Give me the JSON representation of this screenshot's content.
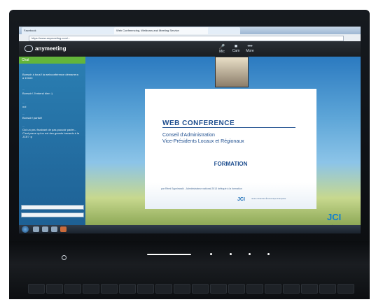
{
  "browser": {
    "tabs": [
      "Facebook",
      "",
      "",
      "Web Conferencing, Webinars and Meeting Service",
      ""
    ],
    "url": "https://www.anymeeting.com/..."
  },
  "app": {
    "logo_text": "anymeeting",
    "toolbar_buttons": [
      "Mic",
      "Cam",
      "More"
    ]
  },
  "chat": {
    "header_label": "Chat",
    "messages": [
      {
        "text": "Bonsoir à tous!! la webconférence démarrera à 19h00"
      },
      {
        "text": "Bonsoir! J'entend bien :)"
      },
      {
        "text": "oui"
      },
      {
        "text": "Bonsoir! parfait!"
      },
      {
        "text": "Ooi un peu frustrant de pas pouvoir parler... C'est parce qu'on est des grands bavards à la JCE? :p"
      }
    ]
  },
  "slide": {
    "title": "WEB CONFERENCE",
    "subtitle_line1": "Conseil d'Administration",
    "subtitle_line2": "Vice-Présidents Locaux et Régionaux",
    "heading": "FORMATION",
    "footer": "par Rémi Sypniewski - Administrateur national 2013 délégué à la formation",
    "brand": "JCI",
    "org_line": "Jeune Chambre Économique Française"
  },
  "colors": {
    "slide_accent": "#1d4d8e",
    "chat_header": "#63b53b",
    "jci_brand": "#0f7fd0"
  }
}
